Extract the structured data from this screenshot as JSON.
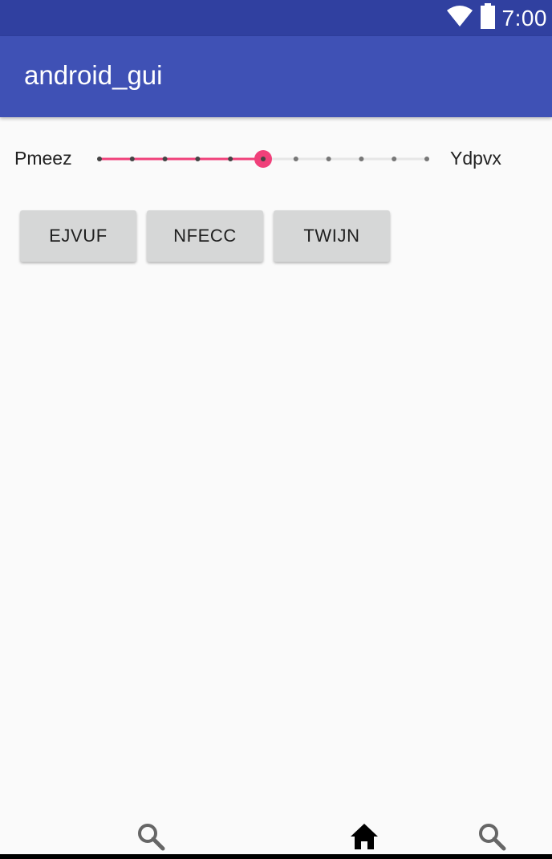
{
  "status_bar": {
    "time": "7:00",
    "icons": [
      "wifi-icon",
      "battery-icon"
    ],
    "background": "#3040a0"
  },
  "app_bar": {
    "title": "android_gui",
    "background": "#3f51b5"
  },
  "slider": {
    "min_label": "Pmeez",
    "max_label": "Ydpvx",
    "steps": 10,
    "value": 5,
    "accent": "#f0407a",
    "track_color": "#e6e6e6"
  },
  "buttons": [
    {
      "label": "EJVUF"
    },
    {
      "label": "NFECC"
    },
    {
      "label": "TWIJN"
    }
  ],
  "bottom_nav": {
    "items": [
      "search-icon",
      "home-icon",
      "search-icon"
    ]
  }
}
